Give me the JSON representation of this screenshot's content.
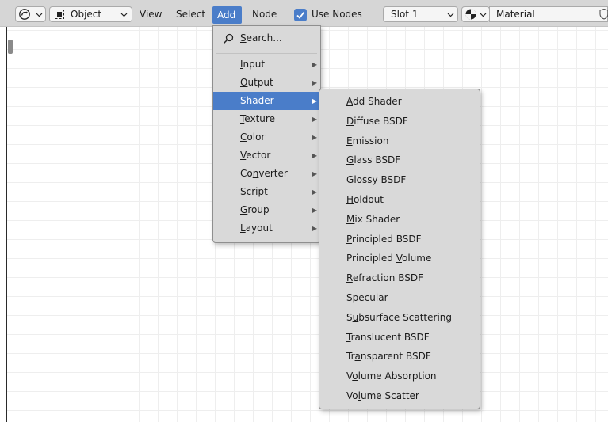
{
  "header": {
    "mode_label": "Object",
    "menus": [
      "View",
      "Select",
      "Add",
      "Node"
    ],
    "use_nodes_label": "Use Nodes",
    "use_nodes_checked": true,
    "slot_label": "Slot 1",
    "material_label": "Material"
  },
  "add_menu": {
    "search_label": "Search...",
    "items": [
      {
        "label": "Input",
        "underline": 0
      },
      {
        "label": "Output",
        "underline": 0
      },
      {
        "label": "Shader",
        "underline": 1
      },
      {
        "label": "Texture",
        "underline": 0
      },
      {
        "label": "Color",
        "underline": 0
      },
      {
        "label": "Vector",
        "underline": 0
      },
      {
        "label": "Converter",
        "underline": 2
      },
      {
        "label": "Script",
        "underline": 2
      },
      {
        "label": "Group",
        "underline": 0
      },
      {
        "label": "Layout",
        "underline": 0
      }
    ],
    "highlighted": "Shader"
  },
  "shader_menu": {
    "items": [
      {
        "label": "Add Shader",
        "underline": 0
      },
      {
        "label": "Diffuse BSDF",
        "underline": 0
      },
      {
        "label": "Emission",
        "underline": 0
      },
      {
        "label": "Glass BSDF",
        "underline": 0
      },
      {
        "label": "Glossy BSDF",
        "underline": 7
      },
      {
        "label": "Holdout",
        "underline": 0
      },
      {
        "label": "Mix Shader",
        "underline": 0
      },
      {
        "label": "Principled BSDF",
        "underline": 0
      },
      {
        "label": "Principled Volume",
        "underline": 11
      },
      {
        "label": "Refraction BSDF",
        "underline": 0
      },
      {
        "label": "Specular",
        "underline": 0
      },
      {
        "label": "Subsurface Scattering",
        "underline": 1
      },
      {
        "label": "Translucent BSDF",
        "underline": 0
      },
      {
        "label": "Transparent BSDF",
        "underline": 2
      },
      {
        "label": "Volume Absorption",
        "underline": 1
      },
      {
        "label": "Volume Scatter",
        "underline": 2
      }
    ]
  },
  "colors": {
    "accent": "#4a7dc9",
    "menu_bg": "#d9d9d9",
    "header_bg": "#d6d6d6"
  }
}
